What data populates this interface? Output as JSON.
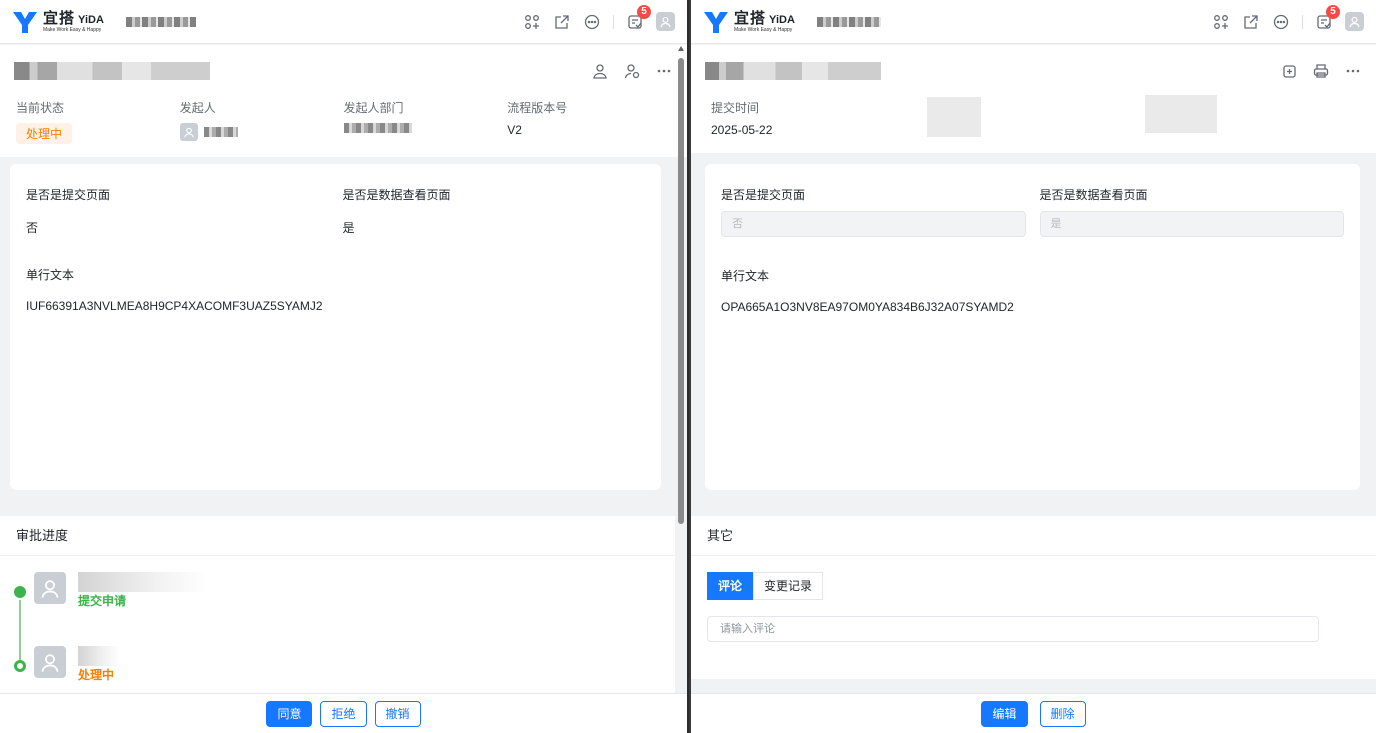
{
  "brand": {
    "name": "宜搭",
    "name_en": "YiDA",
    "tagline": "Make Work Easy & Happy",
    "color": "#1677ff"
  },
  "topbar": {
    "notification_count": "5"
  },
  "left": {
    "meta": [
      {
        "label": "当前状态",
        "value": "处理中"
      },
      {
        "label": "发起人",
        "value": ""
      },
      {
        "label": "发起人部门",
        "value": ""
      },
      {
        "label": "流程版本号",
        "value": "V2"
      }
    ],
    "form": {
      "field1_label": "是否是提交页面",
      "field1_value": "否",
      "field2_label": "是否是数据查看页面",
      "field2_value": "是",
      "field3_label": "单行文本",
      "field3_value": "IUF66391A3NVLMEA8H9CP4XACOMF3UAZ5SYAMJ2"
    },
    "section_title": "审批进度",
    "timeline": [
      {
        "status": "提交申请",
        "color": "#3cb44b"
      },
      {
        "status": "处理中",
        "color": "#ff7d00"
      }
    ],
    "buttons": {
      "agree": "同意",
      "reject": "拒绝",
      "revoke": "撤销"
    }
  },
  "right": {
    "meta": [
      {
        "label": "提交时间",
        "value": "2025-05-22"
      }
    ],
    "form": {
      "field1_label": "是否是提交页面",
      "field1_value": "否",
      "field2_label": "是否是数据查看页面",
      "field2_value": "是",
      "field3_label": "单行文本",
      "field3_value": "OPA665A1O3NV8EA97OM0YA834B6J32A07SYAMD2"
    },
    "section_title": "其它",
    "tabs": [
      "评论",
      "变更记录"
    ],
    "comment_placeholder": "请输入评论",
    "buttons": {
      "edit": "编辑",
      "delete": "删除"
    }
  },
  "colors": {
    "accent": "#1677ff",
    "success": "#3cb44b",
    "warning": "#ff7d00",
    "badge": "#f54a45"
  }
}
